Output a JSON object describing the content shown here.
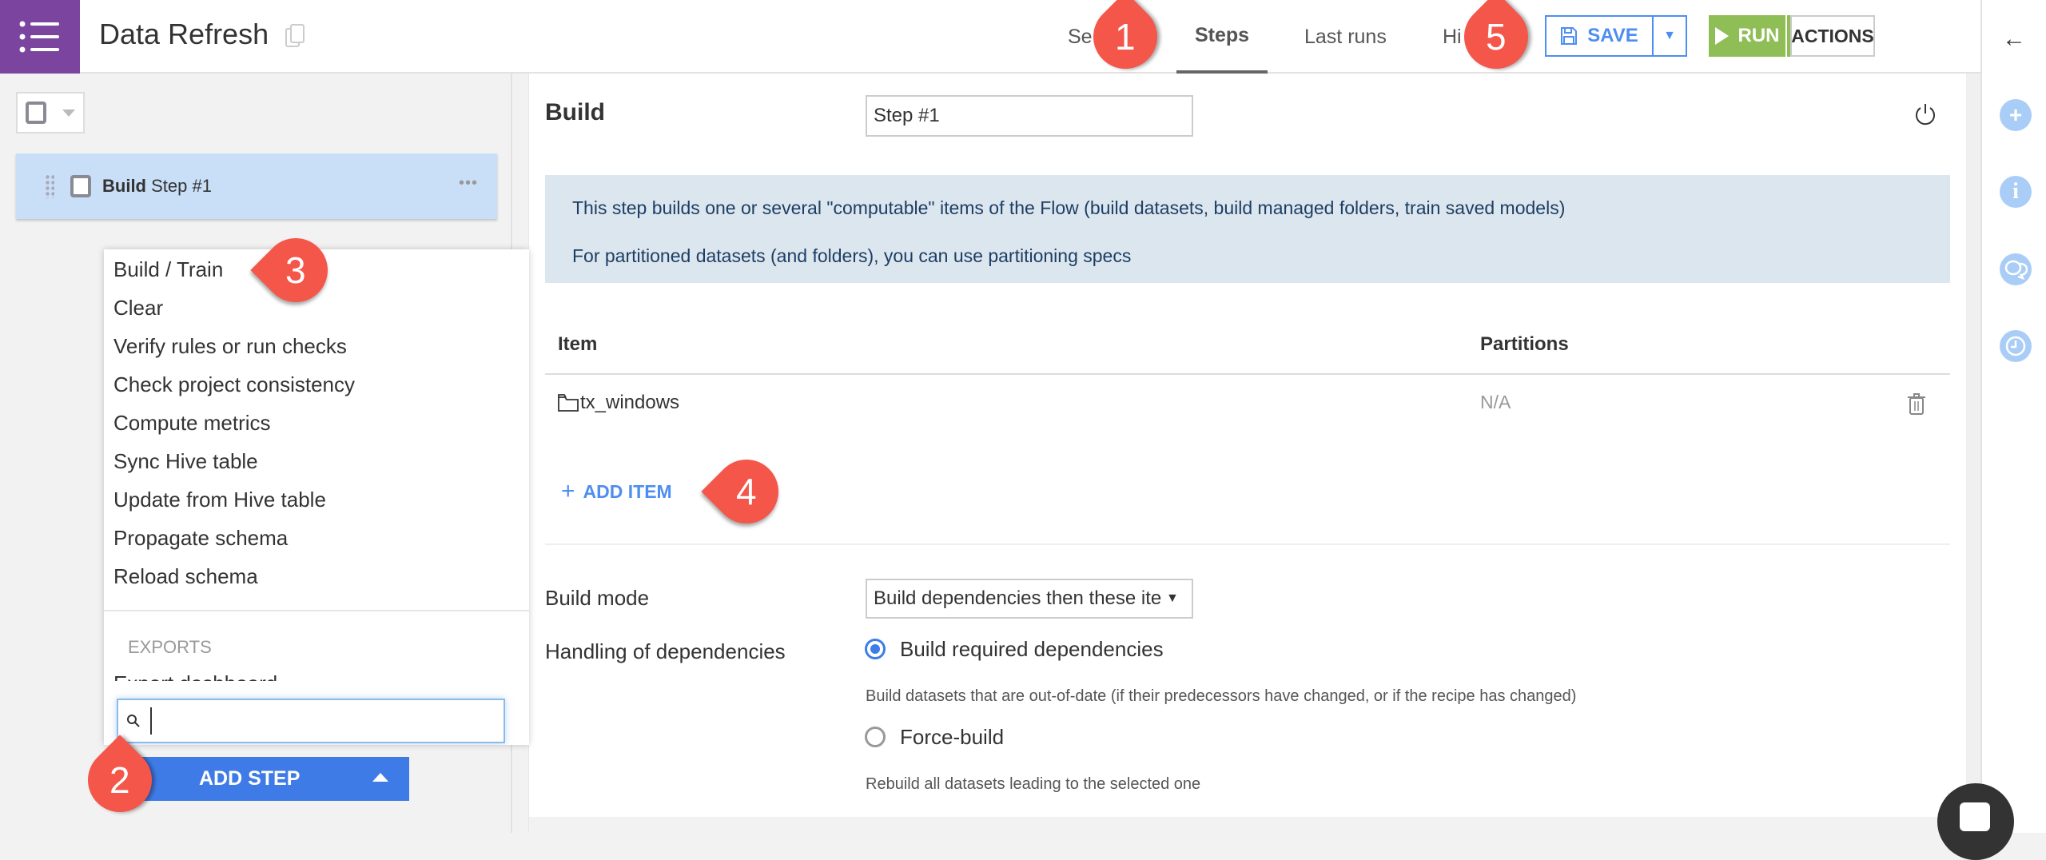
{
  "header": {
    "menu_icon": "list-menu-icon",
    "title": "Data Refresh",
    "copy_icon": "copy-icon",
    "tabs": [
      {
        "label": "Settings",
        "visible_text": "Se"
      },
      {
        "label": "Steps",
        "active": true
      },
      {
        "label": "Last runs"
      },
      {
        "label": "History",
        "visible_text": "Hi"
      }
    ],
    "save_label": "SAVE",
    "run_label": "RUN",
    "actions_label": "ACTIONS",
    "colors": {
      "brand": "#7b459f",
      "save": "#4d8ef0",
      "run": "#8fbe57"
    }
  },
  "right_rail": {
    "back_icon": "arrow-left-icon",
    "icons": [
      "plus-icon",
      "info-icon",
      "discussions-icon",
      "history-clock-icon"
    ]
  },
  "left_panel": {
    "steps": [
      {
        "type": "Build",
        "name": "Step #1"
      }
    ],
    "add_step_label": "ADD STEP"
  },
  "step_menu": {
    "items": [
      "Build / Train",
      "Clear",
      "Verify rules or run checks",
      "Check project consistency",
      "Compute metrics",
      "Sync Hive table",
      "Update from Hive table",
      "Propagate schema",
      "Reload schema"
    ],
    "section_header": "EXPORTS",
    "partial_item": "Export dashboard",
    "search_value": "",
    "search_placeholder": ""
  },
  "main": {
    "step_type": "Build",
    "step_name": "Step #1",
    "info_lines": [
      "This step builds one or several \"computable\" items of the Flow (build datasets, build managed folders, train saved models)",
      "For partitioned datasets (and folders), you can use partitioning specs"
    ],
    "table": {
      "headers": [
        "Item",
        "Partitions"
      ],
      "rows": [
        {
          "item": "tx_windows",
          "icon": "folder-icon",
          "partitions": "N/A"
        }
      ]
    },
    "add_item_label": "ADD ITEM",
    "build_mode_label": "Build mode",
    "build_mode_value": "Build dependencies then these items",
    "dependencies_label": "Handling of dependencies",
    "dependency_options": [
      {
        "label": "Build required dependencies",
        "help": "Build datasets that are out-of-date (if their predecessors have changed, or if the recipe has changed)",
        "selected": true
      },
      {
        "label": "Force-build",
        "help": "Rebuild all datasets leading to the selected one",
        "selected": false
      }
    ]
  },
  "annotations": [
    "1",
    "2",
    "3",
    "4",
    "5"
  ]
}
